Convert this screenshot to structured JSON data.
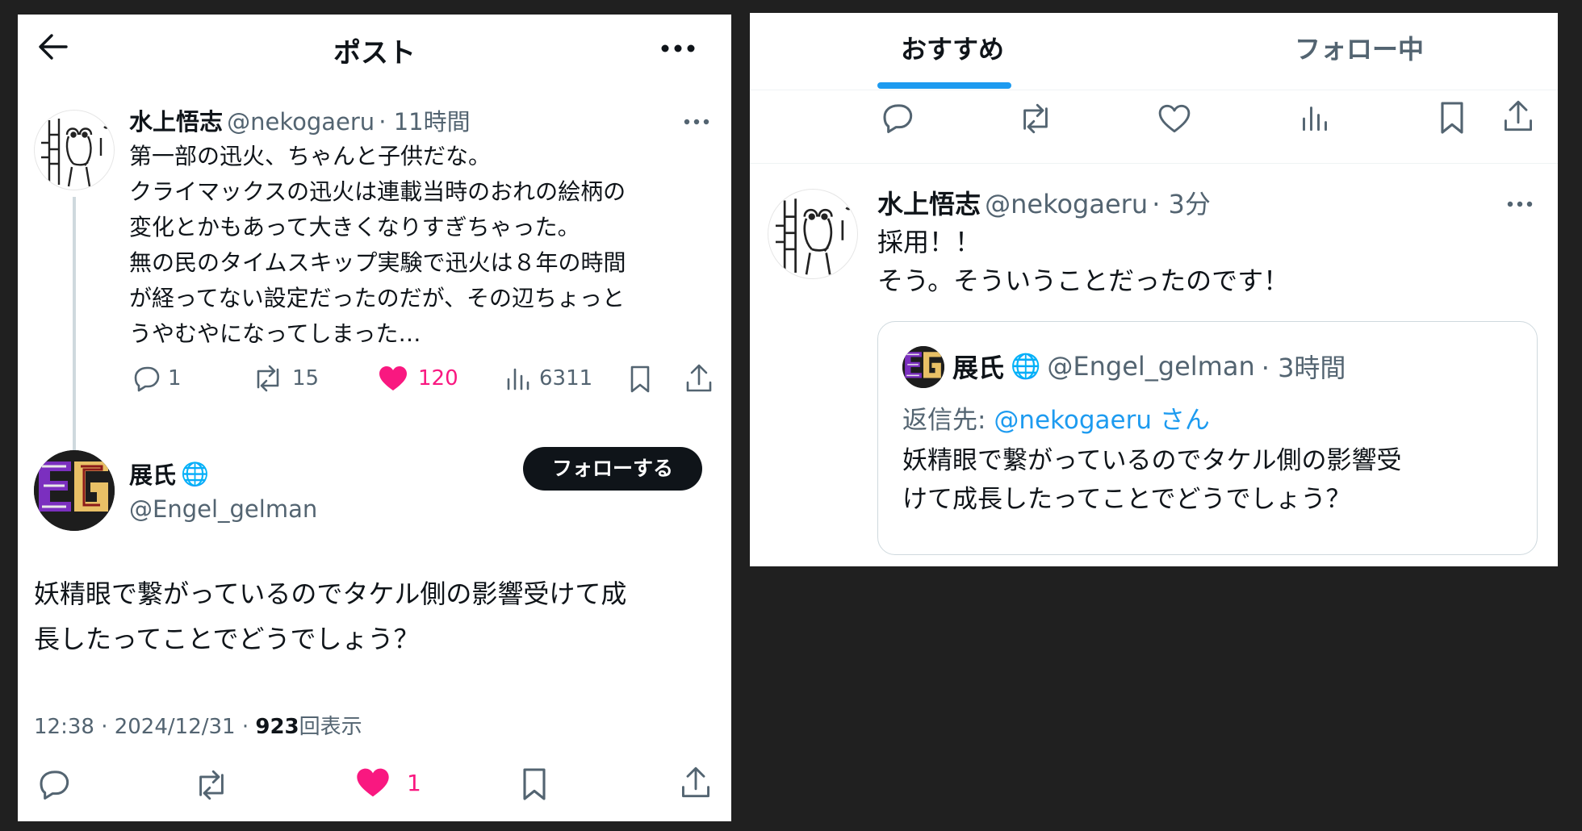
{
  "left_panel": {
    "header": {
      "title": "ポスト",
      "back_icon": "arrow-left-icon",
      "more_icon": "more-icon"
    },
    "parent_tweet": {
      "name": "水上悟志",
      "handle": "@nekogaeru",
      "time": "· 11時間",
      "text": "第一部の迅火、ちゃんと子供だな。\nクライマックスの迅火は連載当時のおれの絵柄の\n変化とかもあって大きくなりすぎちゃった。\n無の民のタイムスキップ実験で迅火は８年の時間\nが経ってない設定だったのだが、その辺ちょっと\nうやむやになってしまった…",
      "stats": {
        "replies": "1",
        "reposts": "15",
        "likes": "120",
        "views": "6311"
      }
    },
    "reply_tweet": {
      "name": "展氏",
      "globe_icon": "🌐",
      "handle": "@Engel_gelman",
      "follow_label": "フォローする",
      "text": "妖精眼で繋がっているのでタケル側の影響受けて成\n長したってことでどうでしょう？",
      "meta_time": "12:38 · 2024/12/31 · ",
      "meta_views": "923",
      "meta_views_label": "回表示",
      "likes": "1"
    },
    "like_color": "#f91880"
  },
  "right_panel": {
    "tabs": [
      {
        "label": "おすすめ",
        "active": true
      },
      {
        "label": "フォロー中",
        "active": false
      }
    ],
    "accent_color": "#1d9bf0",
    "tweet": {
      "name": "水上悟志",
      "handle": "@nekogaeru",
      "time": "· 3分",
      "text": "採用！！\nそう。そういうことだったのです！"
    },
    "quote": {
      "name": "展氏",
      "globe_icon": "🌐",
      "handle": "@Engel_gelman",
      "time": "· 3時間",
      "reply_prefix": "返信先: ",
      "reply_handle": "@nekogaeru",
      "reply_suffix": " さん",
      "text": "妖精眼で繋がっているのでタケル側の影響受\nけて成長したってことでどうでしょう？"
    }
  }
}
